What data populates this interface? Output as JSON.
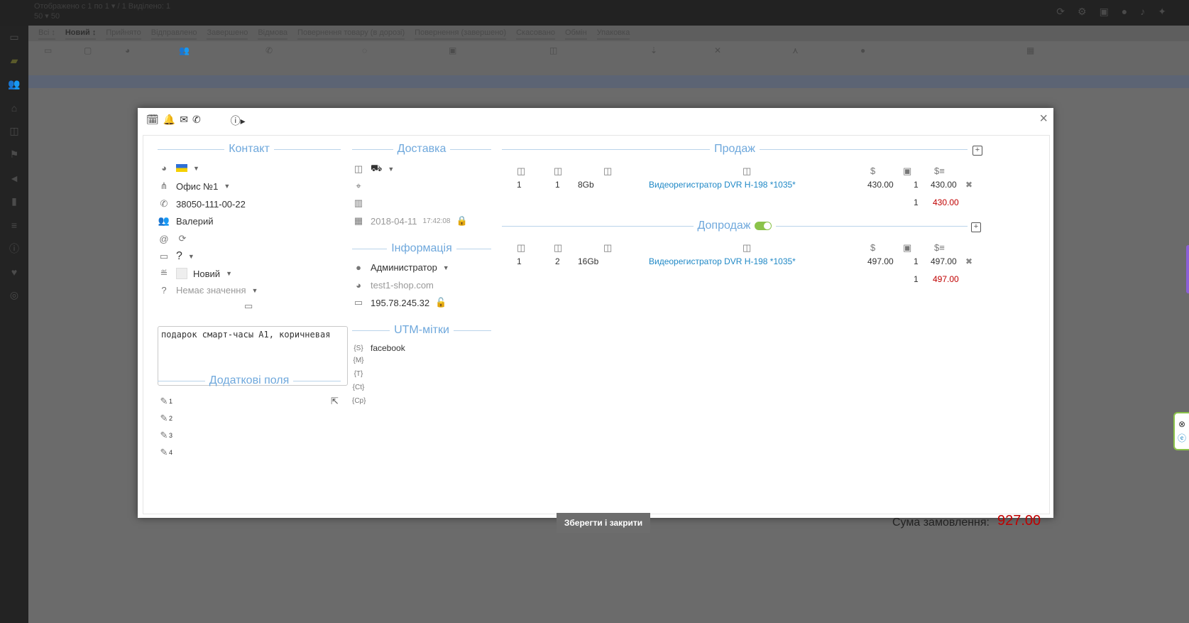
{
  "top": {
    "line1": "Отображено с 1 по 1 ▾    / 1 Виділено: 1",
    "line2": "50   ▾     50"
  },
  "tabs": [
    "Всі ↕",
    "Новий ↕",
    "Прийнято",
    "Відправлено",
    "Завершено",
    "Відмова",
    "Повернення товару (в дорозі)",
    "Повернення (завершено)",
    "Скасовано",
    "Обмін",
    "Упаковка"
  ],
  "modal": {
    "close": "×",
    "contact": {
      "title": "Контакт",
      "office": "Офис №1",
      "phone": "38050-111-00-22",
      "name": "Валерий",
      "question": "?",
      "status": "Новий",
      "no_value": "Немає значення",
      "note": "подарок смарт-часы A1, коричневая"
    },
    "extra": {
      "title": "Додаткові поля",
      "fields": [
        "1",
        "2",
        "3",
        "4"
      ]
    },
    "delivery": {
      "title": "Доставка",
      "date": "2018-04-11",
      "time": "17:42:08"
    },
    "information": {
      "title": "Інформація",
      "user": "Администратор",
      "site": "test1-shop.com",
      "ip": "195.78.245.32"
    },
    "utm": {
      "title": "UTM-мітки",
      "labels": [
        "{S}",
        "{M}",
        "{T}",
        "{Ct}",
        "{Cp}"
      ],
      "source": "facebook"
    },
    "sale": {
      "title": "Продаж",
      "add": "+",
      "row": {
        "c1": "1",
        "c2": "1",
        "c3": "8Gb",
        "product": "Видеорегистратор DVR H-198 *1035*",
        "price": "430.00",
        "qty": "1",
        "sum": "430.00"
      },
      "total_qty": "1",
      "total_sum": "430.00"
    },
    "upsell": {
      "title": "Допродаж",
      "add": "+",
      "row": {
        "c1": "1",
        "c2": "2",
        "c3": "16Gb",
        "product": "Видеорегистратор DVR H-198 *1035*",
        "price": "497.00",
        "qty": "1",
        "sum": "497.00"
      },
      "total_qty": "1",
      "total_sum": "497.00"
    },
    "save_label": "Зберегти і закрити",
    "total_label": "Сума замовлення:",
    "total_value": "927.00"
  }
}
